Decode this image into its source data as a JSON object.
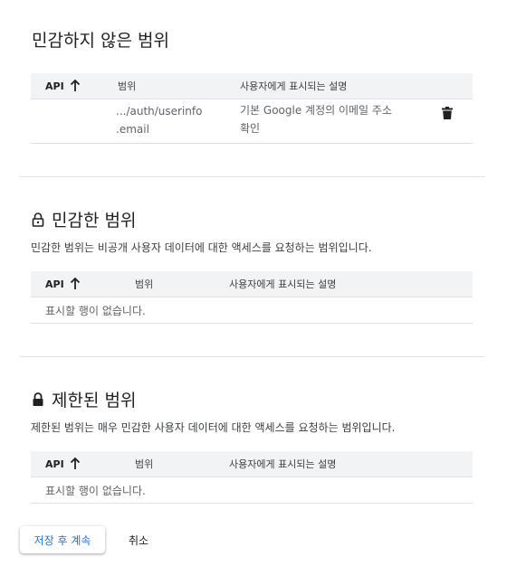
{
  "non_sensitive": {
    "title": "민감하지 않은 범위",
    "headers": {
      "api": "API",
      "scope": "범위",
      "description": "사용자에게 표시되는 설명"
    },
    "rows": [
      {
        "scope_line1": ".../auth/userinfo",
        "scope_line2": ".email",
        "desc_line1": "기본 Google 계정의 이메일 주소",
        "desc_line2": "확인"
      }
    ]
  },
  "sensitive": {
    "title": "민감한 범위",
    "description": "민감한 범위는 비공개 사용자 데이터에 대한 액세스를 요청하는 범위입니다.",
    "headers": {
      "api": "API",
      "scope": "범위",
      "description": "사용자에게 표시되는 설명"
    },
    "empty_text": "표시할 행이 없습니다."
  },
  "restricted": {
    "title": "제한된 범위",
    "description": "제한된 범위는 매우 민감한 사용자 데이터에 대한 액세스를 요청하는 범위입니다.",
    "headers": {
      "api": "API",
      "scope": "범위",
      "description": "사용자에게 표시되는 설명"
    },
    "empty_text": "표시할 행이 없습니다."
  },
  "actions": {
    "save_label": "저장 후 계속",
    "cancel_label": "취소"
  },
  "icons": {
    "sort": "arrow-up-icon",
    "delete": "trash-icon",
    "lock": "lock-icon"
  }
}
